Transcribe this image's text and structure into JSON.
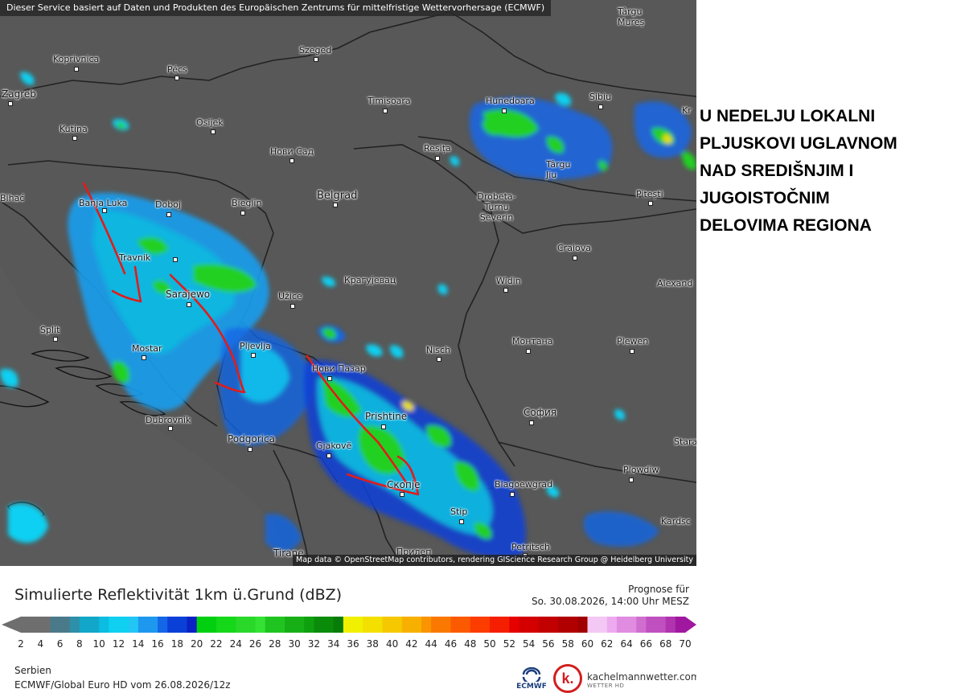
{
  "map": {
    "banner": "Dieser Service basiert auf Daten und Produkten des Europäischen Zentrums für mittelfristige Wettervorhersage (ECMWF)",
    "attribution": "Map data © OpenStreetMap contributors, rendering GIScience Research Group @ Heidelberg University",
    "cities": [
      {
        "name": "Târgu Mureș"
      },
      {
        "name": "Koprivnica"
      },
      {
        "name": "Pécs"
      },
      {
        "name": "Szeged"
      },
      {
        "name": "Zagreb"
      },
      {
        "name": "Osijek"
      },
      {
        "name": "Kutina"
      },
      {
        "name": "Timișoara"
      },
      {
        "name": "Hunedoara"
      },
      {
        "name": "Sibiu"
      },
      {
        "name": "Kr"
      },
      {
        "name": "Нови Сад"
      },
      {
        "name": "Reșița"
      },
      {
        "name": "Târgu Jiu"
      },
      {
        "name": "Pitești"
      },
      {
        "name": "Bihać"
      },
      {
        "name": "Banja Luka"
      },
      {
        "name": "Doboj"
      },
      {
        "name": "Bieglin"
      },
      {
        "name": "Belgrad"
      },
      {
        "name": "Drobeta-Turnu Severin"
      },
      {
        "name": "Craiova"
      },
      {
        "name": "Travnik"
      },
      {
        "name": "Sarajewo"
      },
      {
        "name": "Užice"
      },
      {
        "name": "Крагујевац"
      },
      {
        "name": "Widin"
      },
      {
        "name": "Alexand"
      },
      {
        "name": "Split"
      },
      {
        "name": "Mostar"
      },
      {
        "name": "Pljevlja"
      },
      {
        "name": "Nisch"
      },
      {
        "name": "Монтана"
      },
      {
        "name": "Plewen"
      },
      {
        "name": "Нови Пазар"
      },
      {
        "name": "Dubrovnik"
      },
      {
        "name": "Prishtine"
      },
      {
        "name": "София"
      },
      {
        "name": "Podgorica"
      },
      {
        "name": "Gjakovë"
      },
      {
        "name": "Stara"
      },
      {
        "name": "Plowdiw"
      },
      {
        "name": "Скопје"
      },
      {
        "name": "Blagoewgrad"
      },
      {
        "name": "Stip"
      },
      {
        "name": "Kardsc"
      },
      {
        "name": "Petritsch"
      },
      {
        "name": "Tirane"
      },
      {
        "name": "Прилеп"
      }
    ]
  },
  "annotation": {
    "lines": [
      "U NEDELJU LOKALNI",
      "PLJUSKOVI UGLAVNOM",
      "NAD SREDIŠNJIM I",
      "JUGOISTOČNIM",
      "DELOVIMA REGIONA"
    ]
  },
  "legend": {
    "title": "Simulierte Reflektivität 1km ü.Grund (dBZ)",
    "prognose_label": "Prognose für",
    "prognose_date": "So. 30.08.2026, 14:00 Uhr MESZ",
    "ticks": [
      2,
      4,
      6,
      8,
      10,
      12,
      14,
      16,
      18,
      20,
      22,
      24,
      26,
      28,
      30,
      32,
      34,
      36,
      38,
      40,
      42,
      44,
      46,
      48,
      50,
      52,
      54,
      56,
      58,
      60,
      62,
      64,
      66,
      68,
      70
    ],
    "colors": {
      "grays": "#6e6e6e",
      "blues": [
        "#4a7a8a",
        "#2e8fa8",
        "#12a6c8",
        "#0bbde0",
        "#10d0f2",
        "#22c6f5",
        "#1e98ee",
        "#1466e6",
        "#0a3fd8",
        "#0a22c2"
      ],
      "greens": [
        "#00d010",
        "#14d818",
        "#2ad82a",
        "#34e234",
        "#20c420",
        "#16b016",
        "#0fa00f",
        "#0a8c0a",
        "#087c08"
      ],
      "yellows_reds": [
        "#f0f000",
        "#f4e000",
        "#f6c800",
        "#f8b000",
        "#fa9400",
        "#fb7800",
        "#fc5a00",
        "#fd3c00",
        "#f51e00",
        "#e60000",
        "#d40000",
        "#c20000",
        "#b00000",
        "#a00000"
      ],
      "pinks": [
        "#f4c8f4",
        "#eeaaee",
        "#e08ce0",
        "#d06ed0",
        "#c050c0",
        "#b034b0",
        "#a018a0"
      ]
    }
  },
  "footer": {
    "region": "Serbien",
    "model_run": "ECMWF/Global Euro HD vom  26.08.2026/12z",
    "ecmwf_logo_text": "ECMWF",
    "km_logo_letter": "k.",
    "km_name": "kachelmannwetter.com",
    "km_sub": "WETTER HD"
  }
}
